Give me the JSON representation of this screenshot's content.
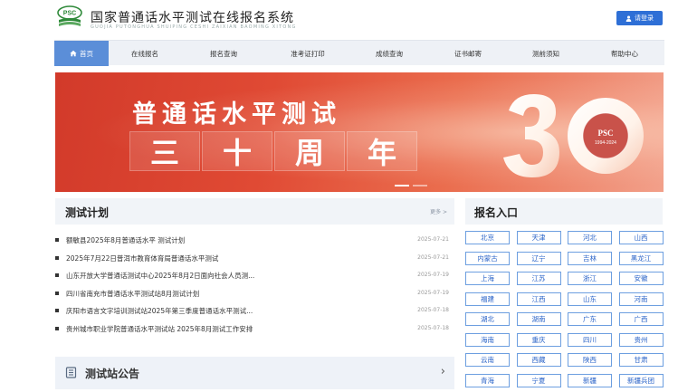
{
  "header": {
    "logo_text": "PSC",
    "title": "国家普通话水平测试在线报名系统",
    "subtitle": "GUOJIA PUTONGHUA SHUIPING CESHI ZAIXIAN BAOMING XITONG",
    "login_label": "请登录"
  },
  "nav": {
    "items": [
      {
        "label": "首页"
      },
      {
        "label": "在线报名"
      },
      {
        "label": "报名查询"
      },
      {
        "label": "准考证打印"
      },
      {
        "label": "成绩查询"
      },
      {
        "label": "证书邮寄"
      },
      {
        "label": "测前须知"
      },
      {
        "label": "帮助中心"
      }
    ]
  },
  "banner": {
    "title": "普通话水平测试",
    "chars": [
      "三",
      "十",
      "周",
      "年"
    ],
    "badge_text": "PSC",
    "badge_years": "1994-2024"
  },
  "plan": {
    "title": "测试计划",
    "more_label": "更多 >",
    "items": [
      {
        "text": "额敏县2025年8月普通话水平 测试计划",
        "date": "2025-07-21"
      },
      {
        "text": "2025年7月22日普洱市教育体育局普通话水平测试",
        "date": "2025-07-21"
      },
      {
        "text": "山东开放大学普通话测试中心2025年8月2日面向社会人员测...",
        "date": "2025-07-19"
      },
      {
        "text": "四川省南充市普通话水平测试站8月测试计划",
        "date": "2025-07-19"
      },
      {
        "text": "庆阳市语言文字培训测试站2025年第三季度普通话水平测试...",
        "date": "2025-07-18"
      },
      {
        "text": "贵州城市职业学院普通话水平测试站 2025年8月测试工作安排",
        "date": "2025-07-18"
      }
    ]
  },
  "notice": {
    "title": "测试站公告",
    "arrow": "›"
  },
  "register": {
    "title": "报名入口",
    "provinces": [
      "北京",
      "天津",
      "河北",
      "山西",
      "内蒙古",
      "辽宁",
      "吉林",
      "黑龙江",
      "上海",
      "江苏",
      "浙江",
      "安徽",
      "福建",
      "江西",
      "山东",
      "河南",
      "湖北",
      "湖南",
      "广东",
      "广西",
      "海南",
      "重庆",
      "四川",
      "贵州",
      "云南",
      "西藏",
      "陕西",
      "甘肃",
      "青海",
      "宁夏",
      "新疆",
      "新疆兵团"
    ]
  },
  "colors": {
    "brand_blue": "#2e6fd6",
    "nav_active": "#5b8ed8",
    "banner_red": "#d23a2a"
  }
}
